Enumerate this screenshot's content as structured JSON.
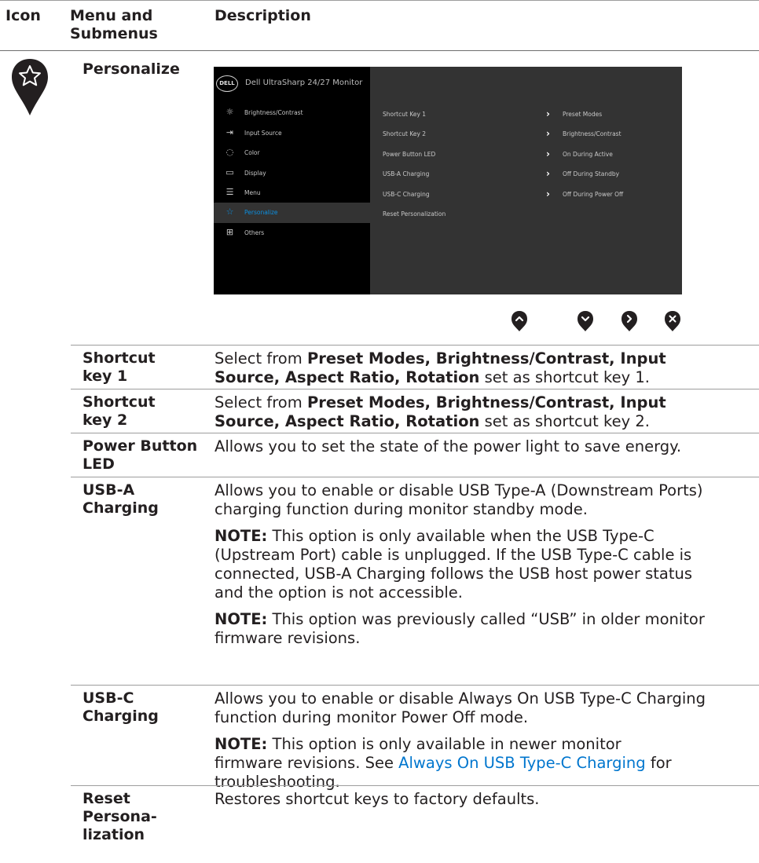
{
  "header": {
    "col_icon": "Icon",
    "col_menu_line1": "Menu and",
    "col_menu_line2": "Submenus",
    "col_desc": "Description"
  },
  "section": {
    "name": "Personalize",
    "icon": "star-pin-icon"
  },
  "osd": {
    "logo": "DELL",
    "title": "Dell UltraSharp 24/27 Monitor",
    "menu": [
      {
        "label": "Brightness/Contrast",
        "icon": "sun-icon"
      },
      {
        "label": "Input Source",
        "icon": "input-icon"
      },
      {
        "label": "Color",
        "icon": "palette-icon"
      },
      {
        "label": "Display",
        "icon": "display-icon"
      },
      {
        "label": "Menu",
        "icon": "menu-icon"
      },
      {
        "label": "Personalize",
        "icon": "star-icon",
        "selected": true
      },
      {
        "label": "Others",
        "icon": "others-icon"
      }
    ],
    "submenu": [
      {
        "label": "Shortcut Key 1",
        "value": "Preset Modes"
      },
      {
        "label": "Shortcut Key 2",
        "value": "Brightness/Contrast"
      },
      {
        "label": "Power Button LED",
        "value": "On During Active"
      },
      {
        "label": "USB-A Charging",
        "value": "Off During Standby"
      },
      {
        "label": "USB-C Charging",
        "value": "Off During Power Off"
      },
      {
        "label": "Reset Personalization",
        "value": ""
      }
    ],
    "colors": {
      "left_bg": "#000000",
      "right_bg": "#333333",
      "accent": "#0b8fe0"
    }
  },
  "nav_buttons": [
    "up-icon",
    "down-icon",
    "right-icon",
    "close-icon"
  ],
  "rows": {
    "sk1": {
      "label_1": "Shortcut",
      "label_2": "key 1",
      "d1": "Select from ",
      "d1b": "Preset Modes, Brightness/Contrast, Input",
      "d2b": "Source, Aspect Ratio, Rotation",
      "d2": " set as shortcut key 1."
    },
    "sk2": {
      "label_1": "Shortcut",
      "label_2": "key 2",
      "d1": "Select from ",
      "d1b": "Preset Modes, Brightness/Contrast, Input",
      "d2b": "Source, Aspect Ratio, Rotation",
      "d2": " set as shortcut key 2."
    },
    "led": {
      "label_1": "Power Button",
      "label_2": "LED",
      "d1": "Allows you to set the state of the power light to save energy."
    },
    "usba": {
      "label_1": "USB-A",
      "label_2": "Charging",
      "p1_l1": "Allows you to enable or disable USB Type-A (Downstream Ports)",
      "p1_l2": "charging function during monitor standby mode.",
      "note_label": "NOTE:",
      "n1_l1": " This option is only available when the USB Type-C",
      "n1_l2": "(Upstream Port) cable is unplugged. If the USB Type-C cable is",
      "n1_l3": "connected, USB-A Charging follows the USB host power status",
      "n1_l4": "and the option is not accessible.",
      "n2_l1": " This option was previously called “USB” in older monitor",
      "n2_l2": "firmware revisions."
    },
    "usbc": {
      "label_1": "USB-C",
      "label_2": "Charging",
      "p1_l1": "Allows you to enable or disable Always On USB Type-C Charging",
      "p1_l2": "function during monitor Power Off mode.",
      "note_label": "NOTE:",
      "n1_l1": " This option is only available in newer monitor",
      "n1_l2a": "firmware revisions.  See ",
      "n1_link": "Always On USB Type-C Charging",
      "n1_l2b": " for",
      "n1_l3": "troubleshooting."
    },
    "reset": {
      "label_1": "Reset",
      "label_2": "Persona-",
      "label_3": "lization",
      "d1": "Restores shortcut keys to factory defaults."
    }
  }
}
